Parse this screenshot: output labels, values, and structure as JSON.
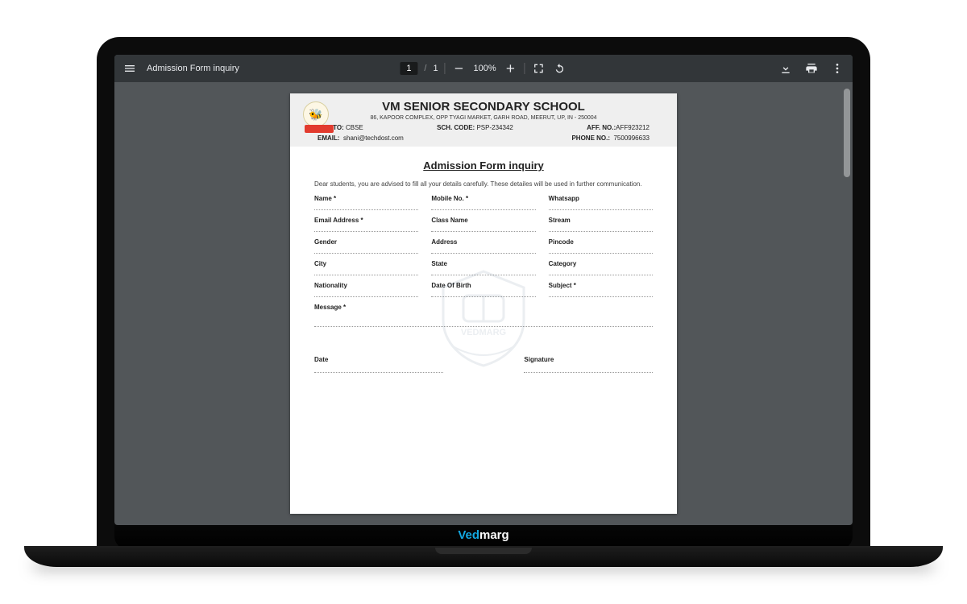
{
  "toolbar": {
    "document_title": "Admission Form inquiry",
    "page_current": "1",
    "page_total": "1",
    "page_separator": "/",
    "zoom_value": "100%"
  },
  "brand": {
    "part1": "Ved",
    "part2": "marg"
  },
  "document": {
    "header": {
      "school_name": "VM SENIOR SECONDARY SCHOOL",
      "address": "86, KAPOOR COMPLEX, OPP TYAGI MARKET, GARH ROAD, MEERUT, UP, IN - 250004",
      "aff_to_label": "AFF. TO:",
      "aff_to_value": "CBSE",
      "sch_code_label": "SCH. CODE:",
      "sch_code_value": "PSP-234342",
      "aff_no_label": "AFF. NO.:",
      "aff_no_value": "AFF923212",
      "email_label": "EMAIL:",
      "email_value": "shani@techdost.com",
      "phone_label": "PHONE NO.:",
      "phone_value": "7500996633"
    },
    "form": {
      "title": "Admission Form inquiry",
      "intro": "Dear students, you are advised to fill all your details carefully. These detailes will be used in further communication.",
      "fields": {
        "name": "Name *",
        "mobile": "Mobile No. *",
        "whatsapp": "Whatsapp",
        "email": "Email Address *",
        "class": "Class Name",
        "stream": "Stream",
        "gender": "Gender",
        "address": "Address",
        "pincode": "Pincode",
        "city": "City",
        "state": "State",
        "category": "Category",
        "nationality": "Nationality",
        "dob": "Date Of Birth",
        "subject": "Subject *",
        "message": "Message *"
      },
      "footer": {
        "date_label": "Date",
        "signature_label": "Signature"
      }
    },
    "watermark": "VEDMARG"
  }
}
